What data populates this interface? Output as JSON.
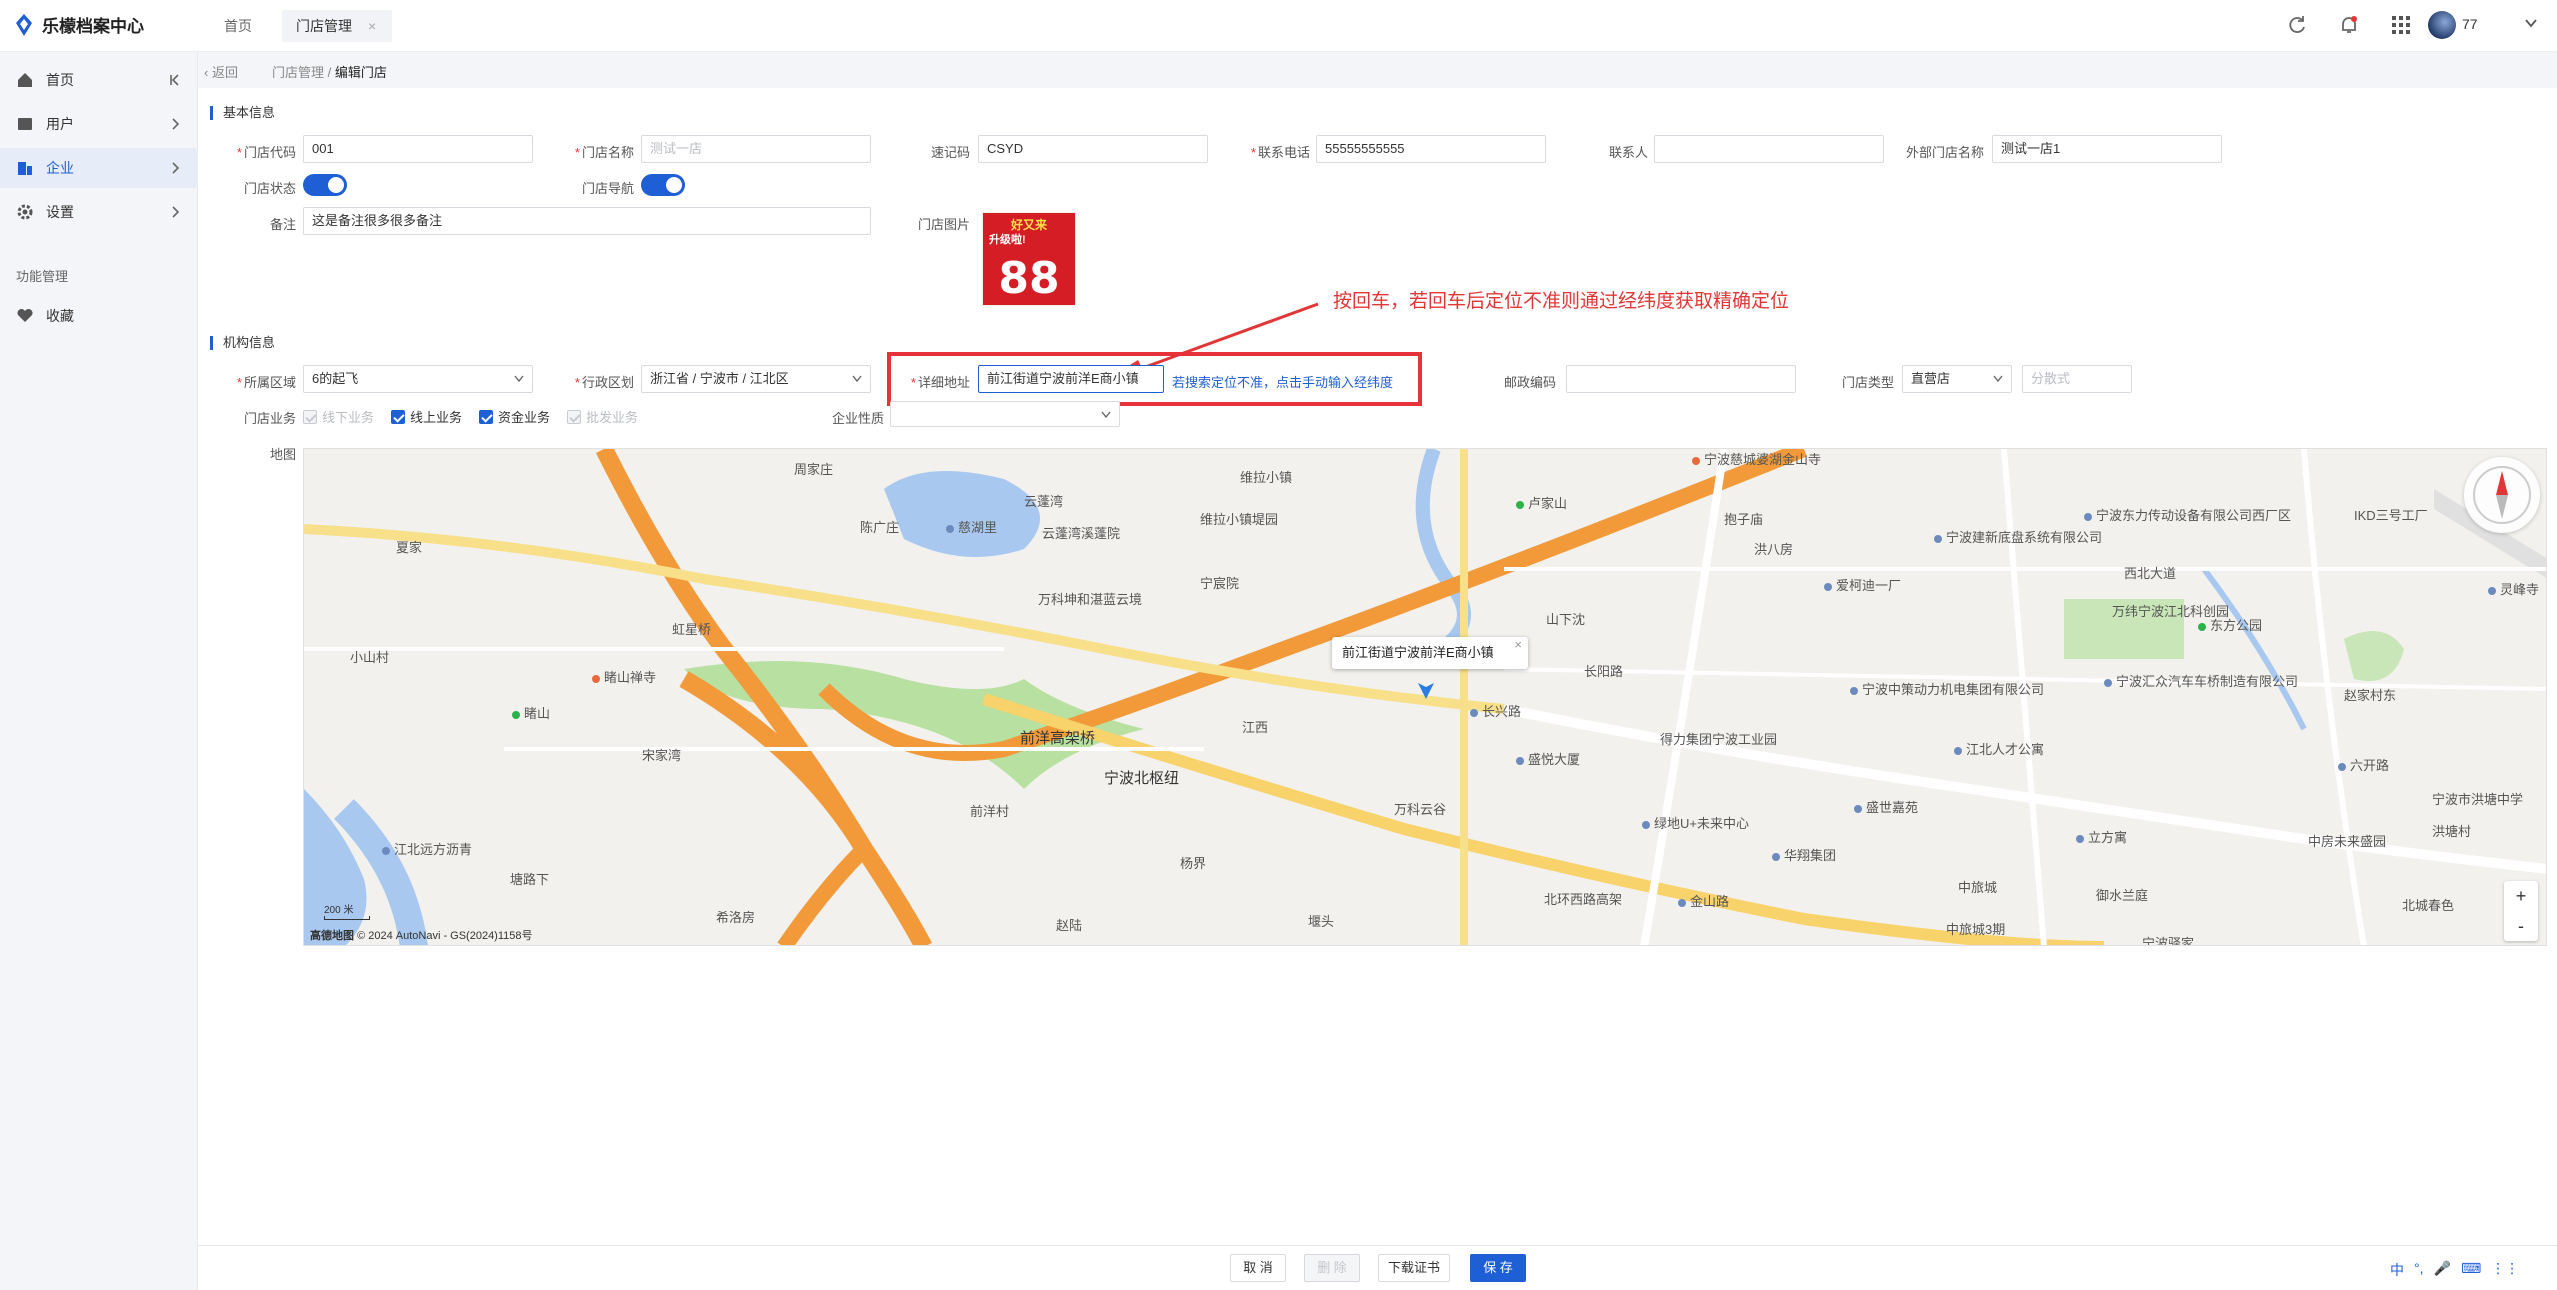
{
  "app": {
    "title": "乐檬档案中心"
  },
  "tabs": [
    {
      "label": "首页"
    },
    {
      "label": "门店管理"
    }
  ],
  "user": {
    "name": "77"
  },
  "sidebar": {
    "items": [
      {
        "label": "首页",
        "icon": "home-icon"
      },
      {
        "label": "用户",
        "icon": "user-icon"
      },
      {
        "label": "企业",
        "icon": "company-icon",
        "active": true
      },
      {
        "label": "设置",
        "icon": "gear-icon"
      }
    ],
    "section": "功能管理",
    "favorites": "收藏"
  },
  "breadcrumb": {
    "back": "返回",
    "parent": "门店管理",
    "sep": "/",
    "current": "编辑门店"
  },
  "basic": {
    "title": "基本信息",
    "store_code": {
      "label": "门店代码",
      "value": "001"
    },
    "store_name": {
      "label": "门店名称",
      "placeholder": "测试一店"
    },
    "quick_code": {
      "label": "速记码",
      "value": "CSYD"
    },
    "phone": {
      "label": "联系电话",
      "value": "55555555555"
    },
    "contact": {
      "label": "联系人",
      "value": ""
    },
    "external_name": {
      "label": "外部门店名称",
      "value": "测试一店1"
    },
    "store_status": {
      "label": "门店状态",
      "on": true
    },
    "store_nav": {
      "label": "门店导航",
      "on": true
    },
    "remark": {
      "label": "备注",
      "value": "这是备注很多很多备注"
    },
    "image": {
      "label": "门店图片",
      "caption_top": "好又来",
      "caption_mid": "升级啦!",
      "caption_big": "88"
    }
  },
  "org": {
    "title": "机构信息",
    "region": {
      "label": "所属区域",
      "value": "6的起飞"
    },
    "admin_area": {
      "label": "行政区划",
      "value": "浙江省 / 宁波市 / 江北区"
    },
    "address": {
      "label": "详细地址",
      "value": "前江街道宁波前洋E商小镇"
    },
    "hint": "若搜索定位不准，点击手动输入经纬度",
    "postcode": {
      "label": "邮政编码",
      "value": ""
    },
    "store_type": {
      "label": "门店类型",
      "value": "直营店",
      "extra_placeholder": "分散式"
    },
    "business": {
      "label": "门店业务",
      "options": [
        {
          "label": "线下业务",
          "checked": true,
          "disabled": true
        },
        {
          "label": "线上业务",
          "checked": true,
          "disabled": false
        },
        {
          "label": "资金业务",
          "checked": true,
          "disabled": false
        },
        {
          "label": "批发业务",
          "checked": true,
          "disabled": true
        }
      ]
    },
    "nature": {
      "label": "企业性质",
      "value": ""
    },
    "map_label": "地图"
  },
  "annotation": {
    "text": "按回车，若回车后定位不准则通过经纬度获取精确定位",
    "color": "#e23636"
  },
  "map": {
    "popup": "前江街道宁波前洋E商小镇",
    "copyright": "© 2024 AutoNavi - GS(2024)1158号",
    "logo": "高德地图",
    "scale": "200 米",
    "zoom_in": "+",
    "zoom_out": "-",
    "labels": [
      "周家庄",
      "云蓬湾",
      "维拉小镇",
      "维拉小镇堤园",
      "宁波慈城婆湖金山寺",
      "卢家山",
      "抱子庙",
      "宁波东力传动设备有限公司西厂区",
      "IKD三号工厂",
      "陈广庄",
      "慈湖里",
      "云蓬湾溪蓬院",
      "宁宸院",
      "宁波建新底盘系统有限公司",
      "洪八房",
      "爱柯迪一厂",
      "夏家",
      "西北大道",
      "万科坤和湛蓝云境",
      "万纬宁波江北科创园",
      "东方公园",
      "灵峰寺",
      "虹星桥",
      "山下沈",
      "小山村",
      "睹山禅寺",
      "宁波中策动力机电集团有限公司",
      "宁波汇众汽车车桥制造有限公司",
      "赵家村东",
      "长阳路",
      "睹山",
      "宋家湾",
      "前洋高架桥",
      "宁波北枢纽",
      "江西",
      "长兴路",
      "得力集团宁波工业园",
      "江北人才公寓",
      "六开路",
      "盛悦大厦",
      "盛世嘉苑",
      "万科云谷",
      "宁波市洪塘中学",
      "洪塘村",
      "前洋村",
      "绿地U+未来中心",
      "华翔集团",
      "立方寓",
      "中房未来盛园",
      "江北远方沥青",
      "塘路下",
      "杨界",
      "中旅城",
      "御水兰庭",
      "希洛房",
      "北环西路高架",
      "金山路",
      "中旅城3期",
      "北城春色",
      "赵陆",
      "堰头",
      "宁波驿家"
    ]
  },
  "footer": {
    "cancel": "取 消",
    "delete": "删 除",
    "download": "下载证书",
    "save": "保 存"
  },
  "ime": {
    "zh": "中",
    "dot": "°,",
    "mic": "🎤",
    "keyboard": "⌨",
    "apps": "⋮⋮"
  }
}
